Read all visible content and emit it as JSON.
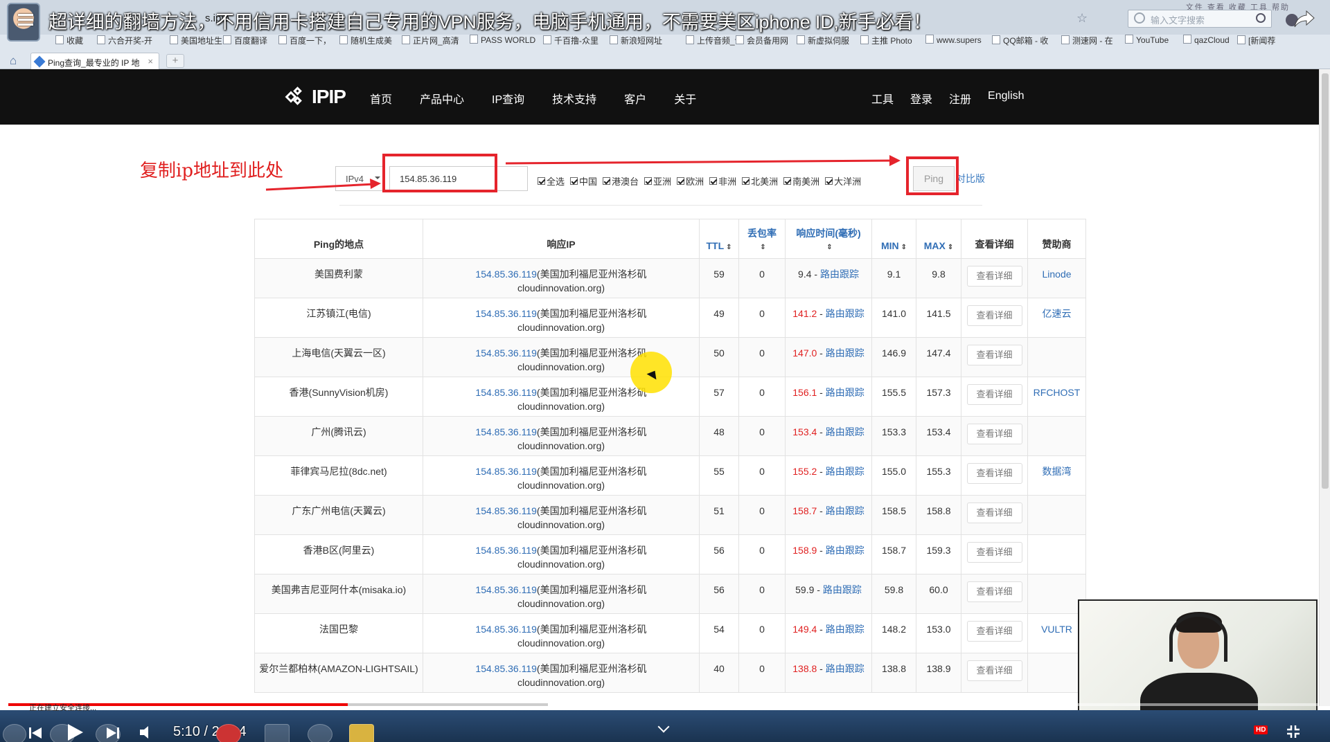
{
  "video": {
    "title": "超详细的翻墙方法，不用信用卡搭建自己专用的VPN服务，电脑手机通用，不需要美区iphone ID,新手必看！",
    "time_current": "5:10",
    "time_total": "20:04",
    "time_display": "5:10 / 20:04",
    "hd_badge": "HD",
    "progress_fraction": 0.259,
    "buffer_fraction": 0.412
  },
  "browser": {
    "address_fragment": "s.ipip",
    "search_placeholder": "输入文字搜索",
    "menu_labels": "文件 查看 收藏 工具 帮助",
    "bookmarks": [
      "收藏",
      "六合开奖-开",
      "美国地址生",
      "百度翻译",
      "百度一下，",
      "随机生成美",
      "正片网_高清",
      "PASS WORLD",
      "千百撸-众里",
      "新浪短网址",
      "上传音频_讯",
      "会员备用网",
      "新虚拟伺服",
      "主推 Photo",
      "www.supers",
      "QQ邮箱 - 收",
      "测速网 - 在",
      "YouTube",
      "qazCloud",
      "[新闻荐"
    ],
    "tab_label": "Ping查询_最专业的 IP 地",
    "status_text": "正在建立安全连接..."
  },
  "site": {
    "logo_text": "IPIP",
    "nav_left": [
      "首页",
      "产品中心",
      "IP查询",
      "技术支持",
      "客户",
      "关于"
    ],
    "nav_right": [
      "工具",
      "登录",
      "注册",
      "English"
    ]
  },
  "form": {
    "annotation": "复制ip地址到此处",
    "ip_version": "IPv4",
    "ip_value": "154.85.36.119",
    "regions": [
      "全选",
      "中国",
      "港澳台",
      "亚洲",
      "欧洲",
      "非洲",
      "北美洲",
      "南美洲",
      "大洋洲"
    ],
    "ping_label": "Ping",
    "compare_label": "对比版"
  },
  "table": {
    "headers": {
      "location": "Ping的地点",
      "response_ip": "响应IP",
      "ttl": "TTL",
      "loss_line1": "丢包率",
      "rt_line1": "响应时间(毫秒)",
      "min": "MIN",
      "max": "MAX",
      "detail": "查看详细",
      "sponsor": "赞助商"
    },
    "sort_glyph": "⇕",
    "route_label": "路由跟踪",
    "detail_button": "查看详细",
    "ip_suffix": "(美国加利福尼亚州洛杉矶",
    "ip_domain": "cloudinnovation.org)",
    "rows": [
      {
        "location": "美国费利蒙",
        "ip": "154.85.36.119",
        "ttl": "59",
        "loss": "0",
        "rt": "9.4",
        "rt_red": false,
        "min": "9.1",
        "max": "9.8",
        "sponsor": "Linode"
      },
      {
        "location": "江苏镇江(电信)",
        "ip": "154.85.36.119",
        "ttl": "49",
        "loss": "0",
        "rt": "141.2",
        "rt_red": true,
        "min": "141.0",
        "max": "141.5",
        "sponsor": "亿速云"
      },
      {
        "location": "上海电信(天翼云一区)",
        "ip": "154.85.36.119",
        "ttl": "50",
        "loss": "0",
        "rt": "147.0",
        "rt_red": true,
        "min": "146.9",
        "max": "147.4",
        "sponsor": ""
      },
      {
        "location": "香港(SunnyVision机房)",
        "ip": "154.85.36.119",
        "ttl": "57",
        "loss": "0",
        "rt": "156.1",
        "rt_red": true,
        "min": "155.5",
        "max": "157.3",
        "sponsor": "RFCHOST"
      },
      {
        "location": "广州(腾讯云)",
        "ip": "154.85.36.119",
        "ttl": "48",
        "loss": "0",
        "rt": "153.4",
        "rt_red": true,
        "min": "153.3",
        "max": "153.4",
        "sponsor": ""
      },
      {
        "location": "菲律宾马尼拉(8dc.net)",
        "ip": "154.85.36.119",
        "ttl": "55",
        "loss": "0",
        "rt": "155.2",
        "rt_red": true,
        "min": "155.0",
        "max": "155.3",
        "sponsor": "数据湾"
      },
      {
        "location": "广东广州电信(天翼云)",
        "ip": "154.85.36.119",
        "ttl": "51",
        "loss": "0",
        "rt": "158.7",
        "rt_red": true,
        "min": "158.5",
        "max": "158.8",
        "sponsor": ""
      },
      {
        "location": "香港B区(阿里云)",
        "ip": "154.85.36.119",
        "ttl": "56",
        "loss": "0",
        "rt": "158.9",
        "rt_red": true,
        "min": "158.7",
        "max": "159.3",
        "sponsor": ""
      },
      {
        "location": "美国弗吉尼亚阿什本(misaka.io)",
        "ip": "154.85.36.119",
        "ttl": "56",
        "loss": "0",
        "rt": "59.9",
        "rt_red": false,
        "min": "59.8",
        "max": "60.0",
        "sponsor": ""
      },
      {
        "location": "法国巴黎",
        "ip": "154.85.36.119",
        "ttl": "54",
        "loss": "0",
        "rt": "149.4",
        "rt_red": true,
        "min": "148.2",
        "max": "153.0",
        "sponsor": "VULTR"
      },
      {
        "location": "爱尔兰都柏林(AMAZON-LIGHTSAIL)",
        "ip": "154.85.36.119",
        "ttl": "40",
        "loss": "0",
        "rt": "138.8",
        "rt_red": true,
        "min": "138.8",
        "max": "138.9",
        "sponsor": ""
      }
    ]
  },
  "colors": {
    "header_bg": "#111111",
    "link_blue": "#2f6db5",
    "alert_red": "#e02020",
    "annotation_red": "#e5242c"
  },
  "icons": {
    "menu": "hamburger-icon",
    "share": "share-icon",
    "home": "home-icon",
    "search": "search-icon",
    "fullscreen": "fullscreen-icon"
  }
}
